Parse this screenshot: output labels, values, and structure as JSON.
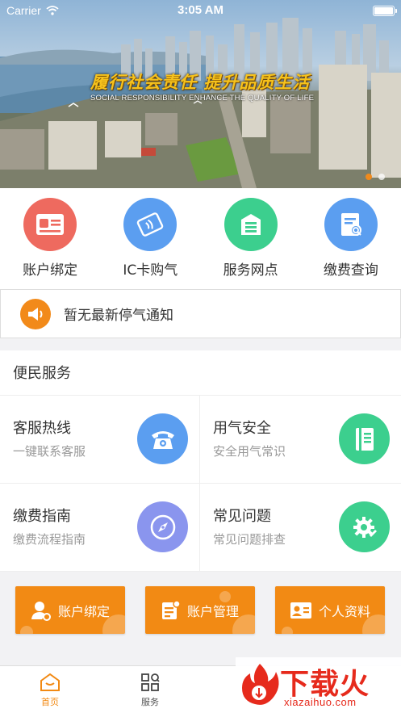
{
  "status_bar": {
    "carrier": "Carrier",
    "time": "3:05 AM"
  },
  "banner": {
    "slogan": "履行社会责任 提升品质生活",
    "slogan_en": "SOCIAL RESPONSIBILITY ENHANCE THE QUALITY OF LIFE",
    "slide_count": 2,
    "active_slide": 1
  },
  "quick_actions": [
    {
      "label": "账户绑定",
      "icon": "id-card-icon",
      "color": "#ee6a5f"
    },
    {
      "label": "IC卡购气",
      "icon": "nfc-card-icon",
      "color": "#5b9ef0"
    },
    {
      "label": "服务网点",
      "icon": "service-point-icon",
      "color": "#3ccf8e"
    },
    {
      "label": "缴费查询",
      "icon": "bill-search-icon",
      "color": "#5b9ef0"
    }
  ],
  "notice": {
    "text": "暂无最新停气通知",
    "icon": "megaphone-icon",
    "color": "#f28a1a"
  },
  "services": {
    "title": "便民服务",
    "items": [
      {
        "name": "客服热线",
        "desc": "一键联系客服",
        "icon": "phone-icon",
        "color": "#5b9ef0"
      },
      {
        "name": "用气安全",
        "desc": "安全用气常识",
        "icon": "notebook-icon",
        "color": "#3ccf8e"
      },
      {
        "name": "缴费指南",
        "desc": "缴费流程指南",
        "icon": "compass-icon",
        "color": "#8a95ee"
      },
      {
        "name": "常见问题",
        "desc": "常见问题排查",
        "icon": "tools-gear-icon",
        "color": "#3ccf8e"
      }
    ]
  },
  "action_buttons": [
    {
      "label": "账户绑定",
      "icon": "user-bind-icon"
    },
    {
      "label": "账户管理",
      "icon": "account-manage-icon"
    },
    {
      "label": "个人资料",
      "icon": "profile-card-icon"
    }
  ],
  "tabbar": {
    "tabs": [
      {
        "label": "首页",
        "icon": "home-icon",
        "active": true
      },
      {
        "label": "服务",
        "icon": "services-grid-icon",
        "active": false
      }
    ],
    "accent": "#f28a14"
  },
  "watermark": {
    "cn": "下载火",
    "en": "xiazaihuo.com"
  }
}
